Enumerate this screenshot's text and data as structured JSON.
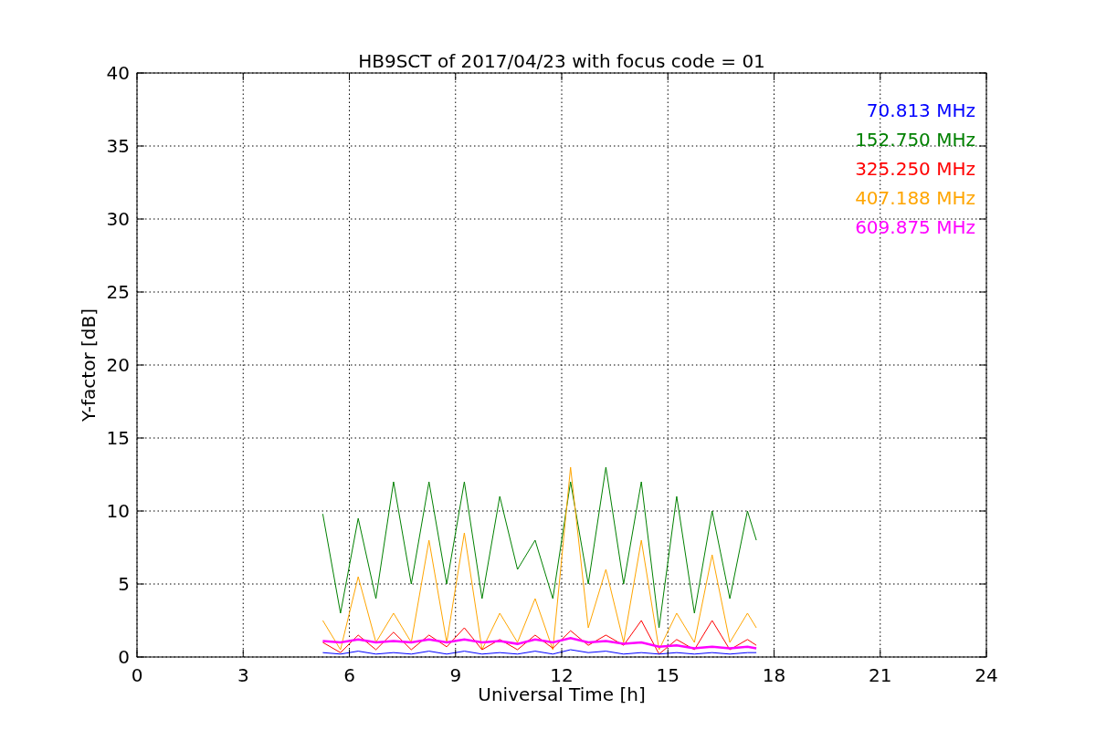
{
  "chart": {
    "chart_data": {
      "type": "line",
      "title": "HB9SCT of 2017/04/23 with focus code = 01",
      "xlabel": "Universal Time [h]",
      "ylabel": "Y-factor [dB]",
      "xlim": [
        0,
        24
      ],
      "ylim": [
        0,
        40
      ],
      "xticks": [
        0,
        3,
        6,
        9,
        12,
        15,
        18,
        21,
        24
      ],
      "yticks": [
        0,
        5,
        10,
        15,
        20,
        25,
        30,
        35,
        40
      ],
      "grid": true,
      "x": [
        5.25,
        5.75,
        6.25,
        6.75,
        7.25,
        7.75,
        8.25,
        8.75,
        9.25,
        9.75,
        10.25,
        10.75,
        11.25,
        11.75,
        12.25,
        12.75,
        13.25,
        13.75,
        14.25,
        14.75,
        15.25,
        15.75,
        16.25,
        16.75,
        17.25,
        17.5
      ],
      "series": [
        {
          "name": "70.813 MHz",
          "color": "#0000ff",
          "values": [
            0.3,
            0.2,
            0.4,
            0.2,
            0.3,
            0.2,
            0.4,
            0.2,
            0.4,
            0.2,
            0.3,
            0.2,
            0.4,
            0.2,
            0.5,
            0.3,
            0.4,
            0.2,
            0.3,
            0.2,
            0.3,
            0.2,
            0.3,
            0.2,
            0.3,
            0.3
          ]
        },
        {
          "name": "152.750 MHz",
          "color": "#008000",
          "values": [
            9.8,
            3,
            9.5,
            4,
            12,
            5,
            12,
            5,
            12,
            4,
            11,
            6,
            8,
            4,
            12,
            5,
            13,
            5,
            12,
            2,
            11,
            3,
            10,
            4,
            10,
            8
          ]
        },
        {
          "name": "325.250 MHz",
          "color": "#ff0000",
          "values": [
            1,
            0.3,
            1.5,
            0.5,
            1.7,
            0.5,
            1.5,
            0.7,
            2,
            0.5,
            1.2,
            0.5,
            1.5,
            0.6,
            1.8,
            0.8,
            1.5,
            0.8,
            2.5,
            0.2,
            1.2,
            0.5,
            2.5,
            0.5,
            1.2,
            0.8
          ]
        },
        {
          "name": "407.188 MHz",
          "color": "#ffa500",
          "values": [
            2.5,
            0.5,
            5.5,
            1,
            3,
            1,
            8,
            1,
            8.5,
            0.5,
            3,
            1,
            4,
            0.5,
            13,
            2,
            6,
            1,
            8,
            0.5,
            3,
            1,
            7,
            1,
            3,
            2
          ]
        },
        {
          "name": "609.875 MHz",
          "color": "#ff00ff",
          "values": [
            1.1,
            1,
            1.2,
            1,
            1.1,
            1,
            1.2,
            1,
            1.2,
            1,
            1.1,
            0.9,
            1.2,
            1,
            1.3,
            1,
            1.1,
            0.9,
            1,
            0.7,
            0.8,
            0.6,
            0.7,
            0.6,
            0.7,
            0.6
          ]
        }
      ]
    }
  }
}
